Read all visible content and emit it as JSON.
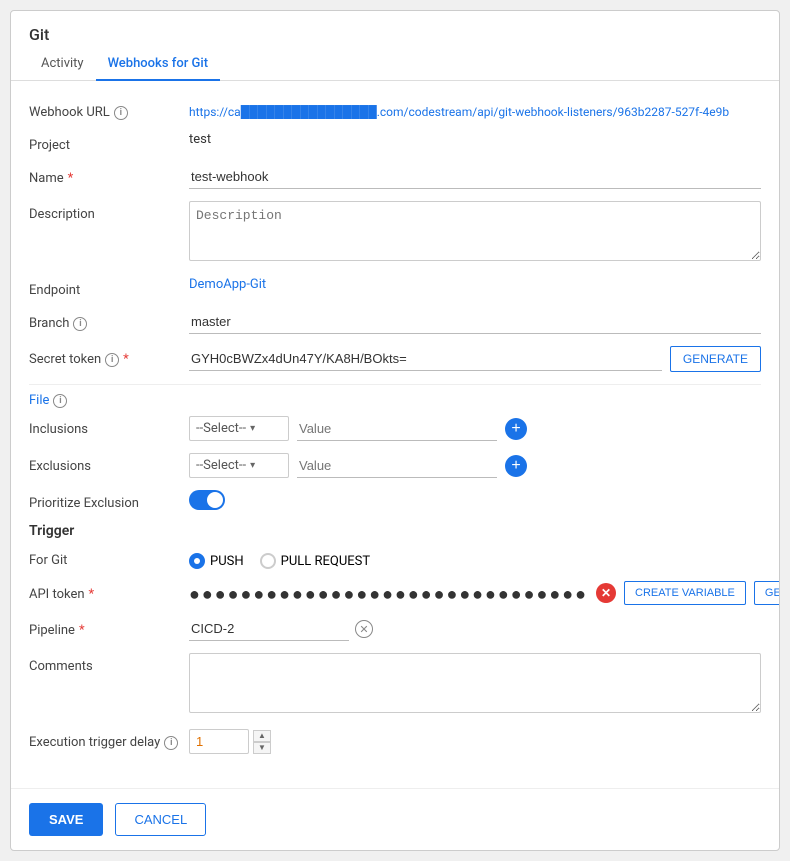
{
  "window": {
    "title": "Git"
  },
  "tabs": [
    {
      "id": "activity",
      "label": "Activity",
      "active": false
    },
    {
      "id": "webhooks",
      "label": "Webhooks for Git",
      "active": true
    }
  ],
  "form": {
    "webhook_url_label": "Webhook URL",
    "webhook_url_value": "https://ca████████████████.com/codestream/api/git-webhook-listeners/963b2287-527f-4e9b",
    "project_label": "Project",
    "project_value": "test",
    "name_label": "Name",
    "name_required": "*",
    "name_value": "test-webhook",
    "description_label": "Description",
    "description_placeholder": "Description",
    "endpoint_label": "Endpoint",
    "endpoint_value": "DemoApp-Git",
    "branch_label": "Branch",
    "branch_value": "master",
    "secret_token_label": "Secret token",
    "secret_token_required": "*",
    "secret_token_value": "GYH0cBWZx4dUn47Y/KA8H/BOkts=",
    "generate_label": "GENERATE",
    "file_label": "File",
    "inclusions_label": "Inclusions",
    "select_placeholder": "--Select--",
    "value_placeholder": "Value",
    "exclusions_label": "Exclusions",
    "prioritize_exclusion_label": "Prioritize Exclusion",
    "trigger_title": "Trigger",
    "for_git_label": "For Git",
    "push_label": "PUSH",
    "pull_request_label": "PULL REQUEST",
    "api_token_label": "API token",
    "api_token_required": "*",
    "api_token_dots": "●●●●●●●●●●●●●●●●●●●●●●●●●●●●●●●",
    "create_variable_label": "CREATE VARIABLE",
    "generate_token_label": "GENERATE TOKEN",
    "pipeline_label": "Pipeline",
    "pipeline_required": "*",
    "pipeline_value": "CICD-2",
    "comments_label": "Comments",
    "execution_trigger_delay_label": "Execution trigger delay",
    "delay_value": "1",
    "save_label": "SAVE",
    "cancel_label": "CANCEL"
  },
  "colors": {
    "accent": "#1a73e8",
    "required": "#e53935",
    "error": "#e53935",
    "toggle_active": "#1a73e8"
  }
}
